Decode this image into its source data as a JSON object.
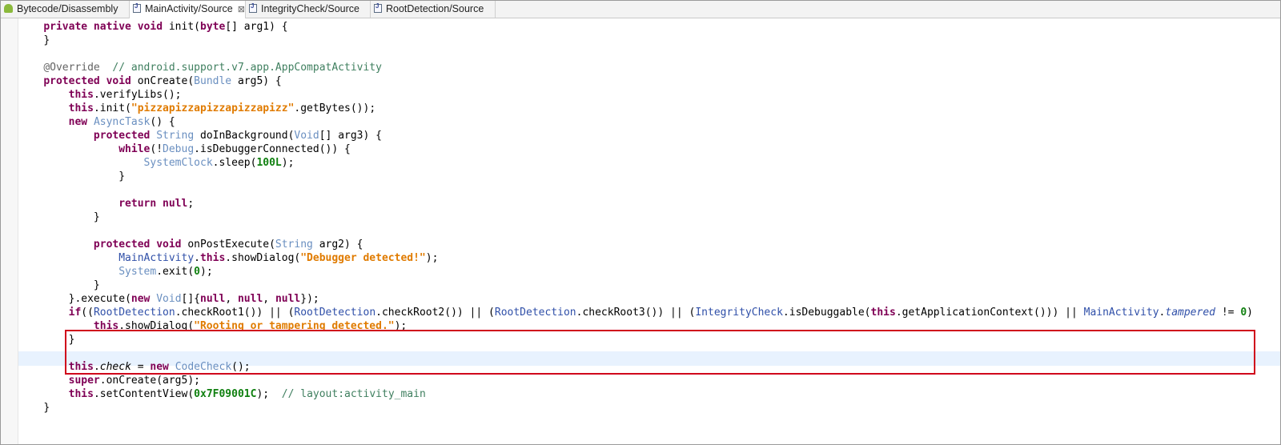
{
  "tabs": [
    {
      "label": "Bytecode/Disassembly",
      "icon": "android-icon",
      "active": false
    },
    {
      "label": "MainActivity/Source",
      "icon": "java-file-icon",
      "active": true,
      "close_icon": "close-icon"
    },
    {
      "label": "IntegrityCheck/Source",
      "icon": "java-file-icon",
      "active": false
    },
    {
      "label": "RootDetection/Source",
      "icon": "java-file-icon",
      "active": false
    }
  ],
  "close_glyph": "⊠",
  "highlight_color": "#d0021b",
  "current_line_color": "#e8f2fe",
  "code": {
    "l1": {
      "a": "private native void ",
      "b": "init(",
      "c": "byte",
      "d": "[] arg1) {"
    },
    "l2": {
      "a": "}"
    },
    "l3": {
      "a": "@Override",
      "b": "  // android.support.v7.app.AppCompatActivity"
    },
    "l4": {
      "a": "protected void ",
      "b": "onCreate(",
      "c": "Bundle",
      "d": " arg5) {"
    },
    "l5": {
      "a": "this",
      "b": ".verifyLibs();"
    },
    "l6": {
      "a": "this",
      "b": ".init(",
      "c": "\"pizzapizzapizzapizzapizz\"",
      "d": ".getBytes());"
    },
    "l7": {
      "a": "new ",
      "b": "AsyncTask",
      "c": "() {"
    },
    "l8": {
      "a": "protected ",
      "b": "String",
      "c": " doInBackground(",
      "d": "Void",
      "e": "[] arg3) {"
    },
    "l9": {
      "a": "while",
      "b": "(!",
      "c": "Debug",
      "d": ".isDebuggerConnected()) {"
    },
    "l10": {
      "a": "SystemClock",
      "b": ".sleep(",
      "c": "100L",
      "d": ");"
    },
    "l11": {
      "a": "}"
    },
    "l12": {
      "a": "return null",
      "b": ";"
    },
    "l13": {
      "a": "}"
    },
    "l14": {
      "a": "protected void ",
      "b": "onPostExecute(",
      "c": "String",
      "d": " arg2) {"
    },
    "l15": {
      "a": "MainActivity",
      "b": ".",
      "c": "this",
      "d": ".showDialog(",
      "e": "\"Debugger detected!\"",
      "f": ");"
    },
    "l16": {
      "a": "System",
      "b": ".exit(",
      "c": "0",
      "d": ");"
    },
    "l17": {
      "a": "}"
    },
    "l18": {
      "a": "}.execute(",
      "b": "new ",
      "c": "Void",
      "d": "[]{",
      "e": "null",
      "f": ", ",
      "g": "null",
      "h": ", ",
      "i": "null",
      "j": "});"
    },
    "l19": {
      "a": "if",
      "b": "((",
      "c": "RootDetection",
      "d": ".checkRoot1()) || (",
      "e": "RootDetection",
      "f": ".checkRoot2()) || (",
      "g": "RootDetection",
      "h": ".checkRoot3()) || (",
      "i": "IntegrityCheck",
      "j": ".isDebuggable(",
      "k": "this",
      "l": ".getApplicationContext())) || ",
      "m": "MainActivity",
      "n": ".",
      "o": "tampered",
      "p": " != ",
      "q": "0",
      "r": ")"
    },
    "l20": {
      "a": "this",
      "b": ".showDialog(",
      "c": "\"Rooting or tampering detected.\"",
      "d": ");"
    },
    "l21": {
      "a": "}"
    },
    "l22": {
      "a": "this",
      "b": ".",
      "c": "check",
      "d": " = ",
      "e": "new ",
      "f": "CodeCheck",
      "g": "();"
    },
    "l23": {
      "a": "super",
      "b": ".onCreate(arg5);"
    },
    "l24": {
      "a": "this",
      "b": ".setContentView(",
      "c": "0x7F09001C",
      "d": ");  ",
      "e": "// layout:activity_main"
    },
    "l25": {
      "a": "}"
    }
  }
}
